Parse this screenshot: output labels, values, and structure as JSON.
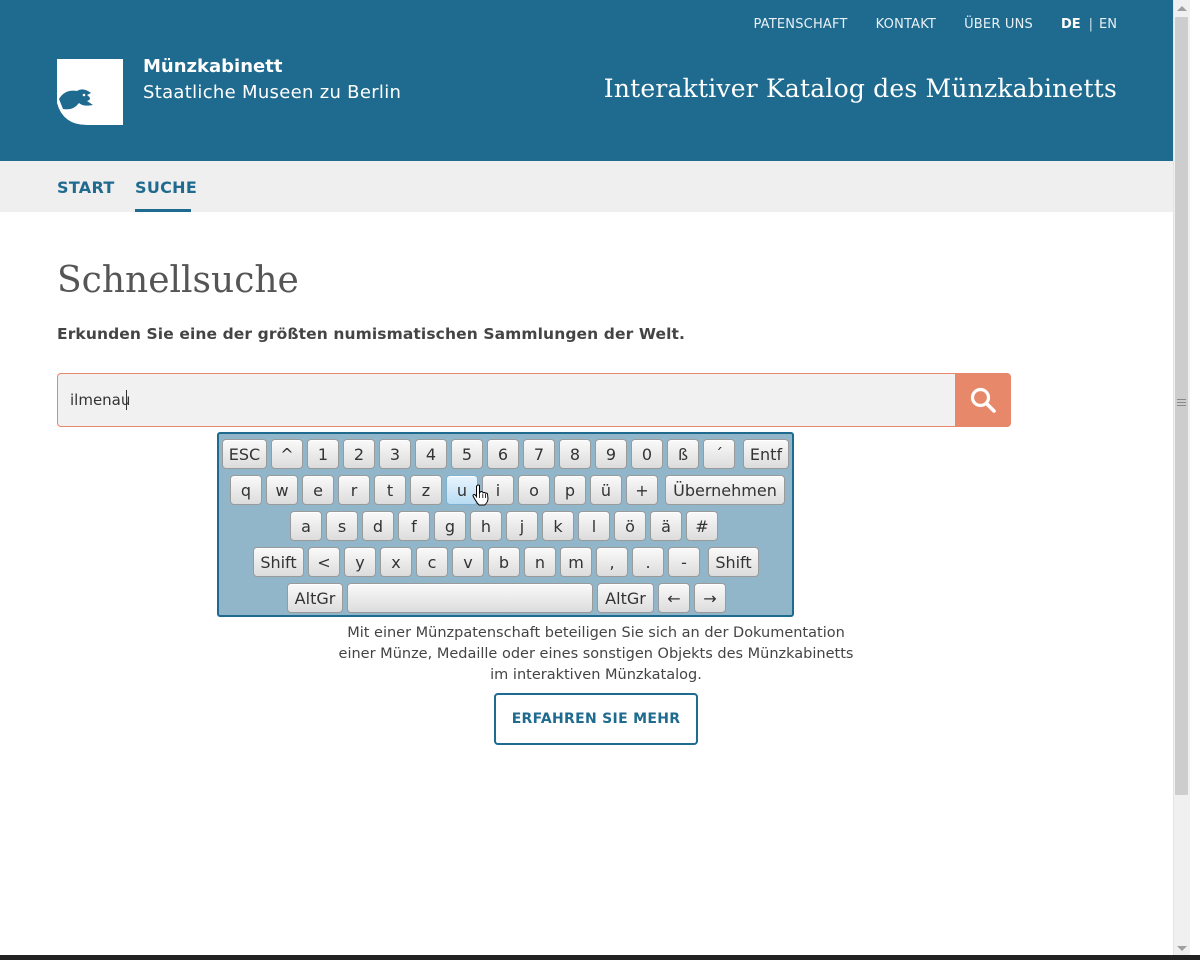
{
  "header": {
    "nav": {
      "patenschaft": "PATENSCHAFT",
      "kontakt": "KONTAKT",
      "ueber_uns": "ÜBER UNS",
      "lang_de": "DE",
      "lang_sep": "|",
      "lang_en": "EN"
    },
    "brand_name": "Münzkabinett",
    "brand_sub": "Staatliche Museen zu Berlin",
    "site_title": "Interaktiver Katalog des Münzkabinetts",
    "logo_icon": "eagle-logo-icon"
  },
  "subnav": {
    "start": "START",
    "suche": "SUCHE"
  },
  "main": {
    "title": "Schnellsuche",
    "intro": "Erkunden Sie eine der größten numismatischen Sammlungen der Welt.",
    "search": {
      "value": "ilmenau",
      "icon": "search-icon"
    }
  },
  "keyboard": {
    "rows": [
      [
        "ESC",
        "^",
        "1",
        "2",
        "3",
        "4",
        "5",
        "6",
        "7",
        "8",
        "9",
        "0",
        "ß",
        "´",
        "Entf"
      ],
      [
        "q",
        "w",
        "e",
        "r",
        "t",
        "z",
        "u",
        "i",
        "o",
        "p",
        "ü",
        "+",
        "Übernehmen"
      ],
      [
        "a",
        "s",
        "d",
        "f",
        "g",
        "h",
        "j",
        "k",
        "l",
        "ö",
        "ä",
        "#"
      ],
      [
        "Shift",
        "<",
        "y",
        "x",
        "c",
        "v",
        "b",
        "n",
        "m",
        ",",
        ".",
        "-",
        "Shift"
      ],
      [
        "AltGr",
        " ",
        "AltGr",
        "←",
        "→"
      ]
    ],
    "hovered_key": "u"
  },
  "sponsor": {
    "line1": "Mit einer Münzpatenschaft beteiligen Sie sich an der Dokumentation",
    "line2": "einer Münze, Medaille oder eines sonstigen Objekts des Münzkabinetts",
    "line3": "im interaktiven Münzkatalog.",
    "button": "ERFAHREN SIE MEHR"
  },
  "colors": {
    "header_bg": "#1f6a8f",
    "accent": "#e8886a",
    "keyboard_bg": "#92b6c9"
  }
}
